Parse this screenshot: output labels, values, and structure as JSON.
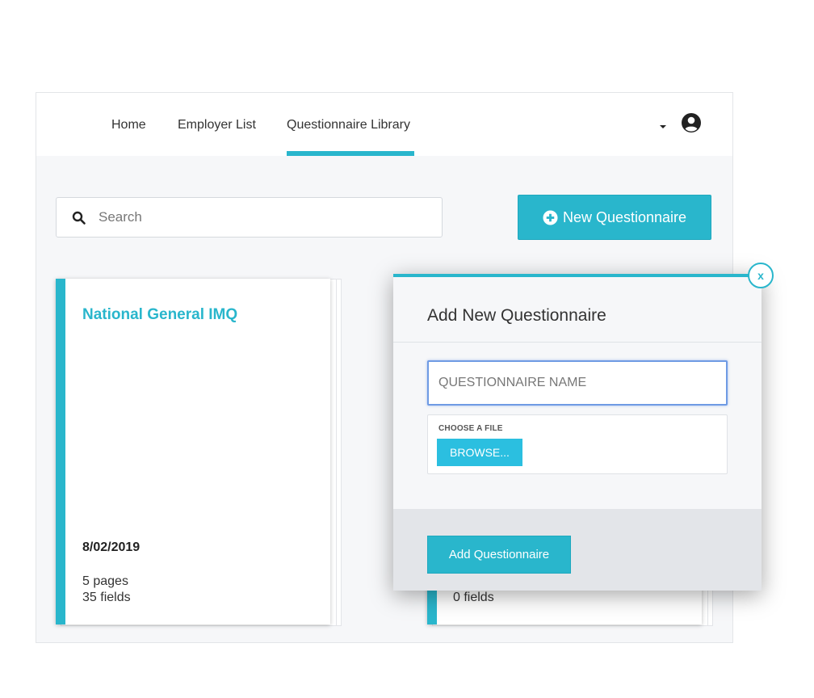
{
  "nav": {
    "items": [
      {
        "label": "Home"
      },
      {
        "label": "Employer List"
      },
      {
        "label": "Questionnaire Library"
      }
    ],
    "active_index": 2
  },
  "search": {
    "placeholder": "Search",
    "value": ""
  },
  "toolbar": {
    "new_label": "New Questionnaire"
  },
  "cards": [
    {
      "title": "National General IMQ",
      "date": "8/02/2019",
      "pages": "5 pages",
      "fields": "35 fields"
    },
    {
      "fields": "0 fields"
    }
  ],
  "modal": {
    "title": "Add New Questionnaire",
    "name_placeholder": "QUESTIONNAIRE NAME",
    "file_label": "CHOOSE A FILE",
    "browse_label": "BROWSE...",
    "submit_label": "Add Questionnaire",
    "close_label": "x"
  },
  "colors": {
    "accent": "#29b6cc",
    "focus": "#6f9be4"
  },
  "icons": [
    "caret-down-icon",
    "user-icon",
    "search-icon",
    "plus-circle-icon"
  ]
}
